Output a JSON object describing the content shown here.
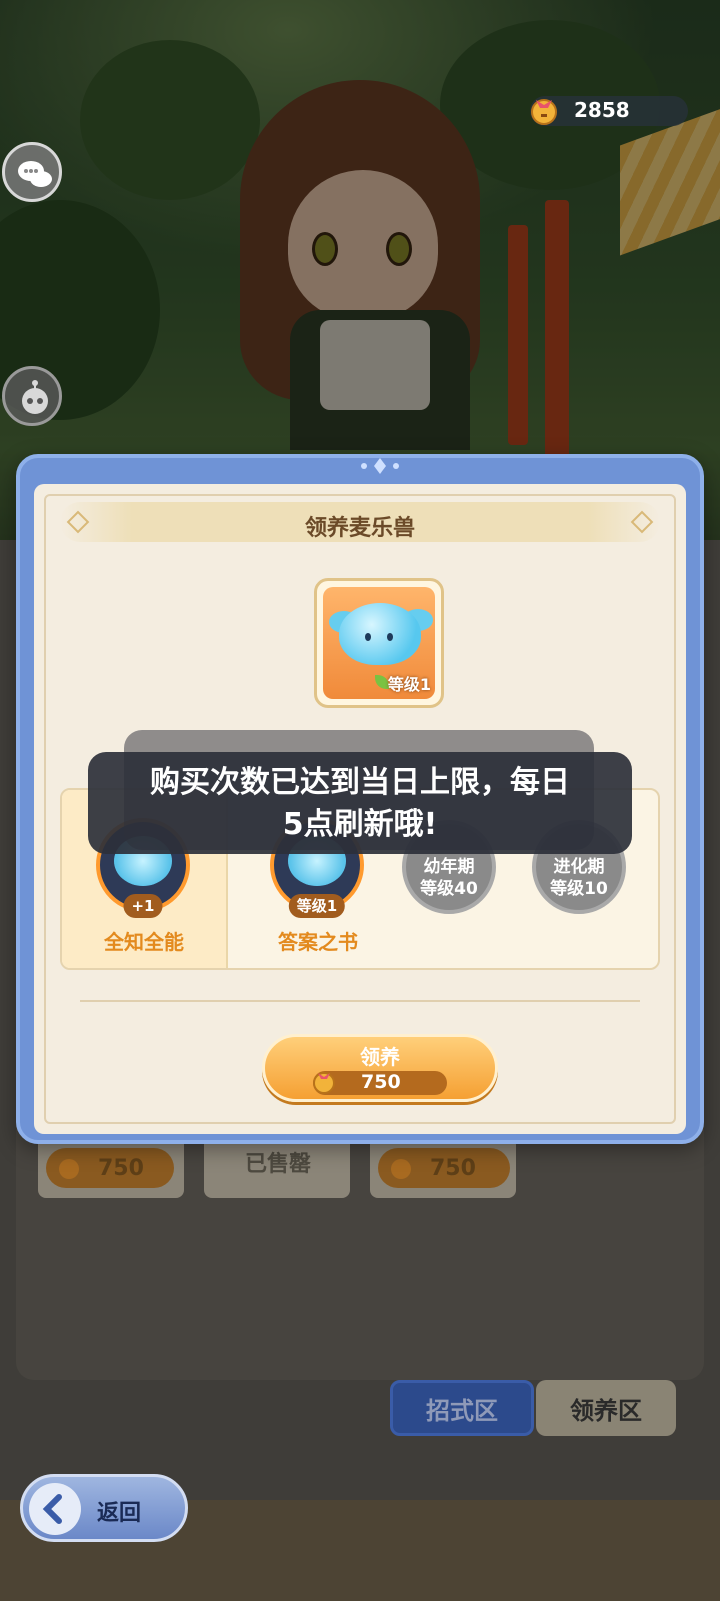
{
  "hud": {
    "currency_amount": "2858",
    "currency_icon": "bell-coin-icon"
  },
  "modal": {
    "title": "领养麦乐兽",
    "pet": {
      "level_label": "等级1"
    },
    "skills": [
      {
        "name": "全知全能",
        "tag": "+1",
        "state": "selected"
      },
      {
        "name": "答案之书",
        "tag": "等级1",
        "state": "unlocked"
      },
      {
        "stage": "幼年期",
        "level": "等级40",
        "state": "locked"
      },
      {
        "stage": "进化期",
        "level": "等级10",
        "state": "locked"
      }
    ],
    "adopt_button": {
      "label": "领养",
      "price": "750"
    }
  },
  "toast": {
    "line1": "购买次数已达到当日上限，每日",
    "line2": "5点刷新哦!"
  },
  "background": {
    "prices": [
      "750",
      "750"
    ],
    "sold_out": "已售罄",
    "tabs": {
      "moves": "招式区",
      "adopt": "领养区"
    },
    "back_button": "返回"
  },
  "colors": {
    "modal_frame": "#6f93d6",
    "accent_orange": "#f5a033",
    "tab_active": "#2c4a8c"
  }
}
